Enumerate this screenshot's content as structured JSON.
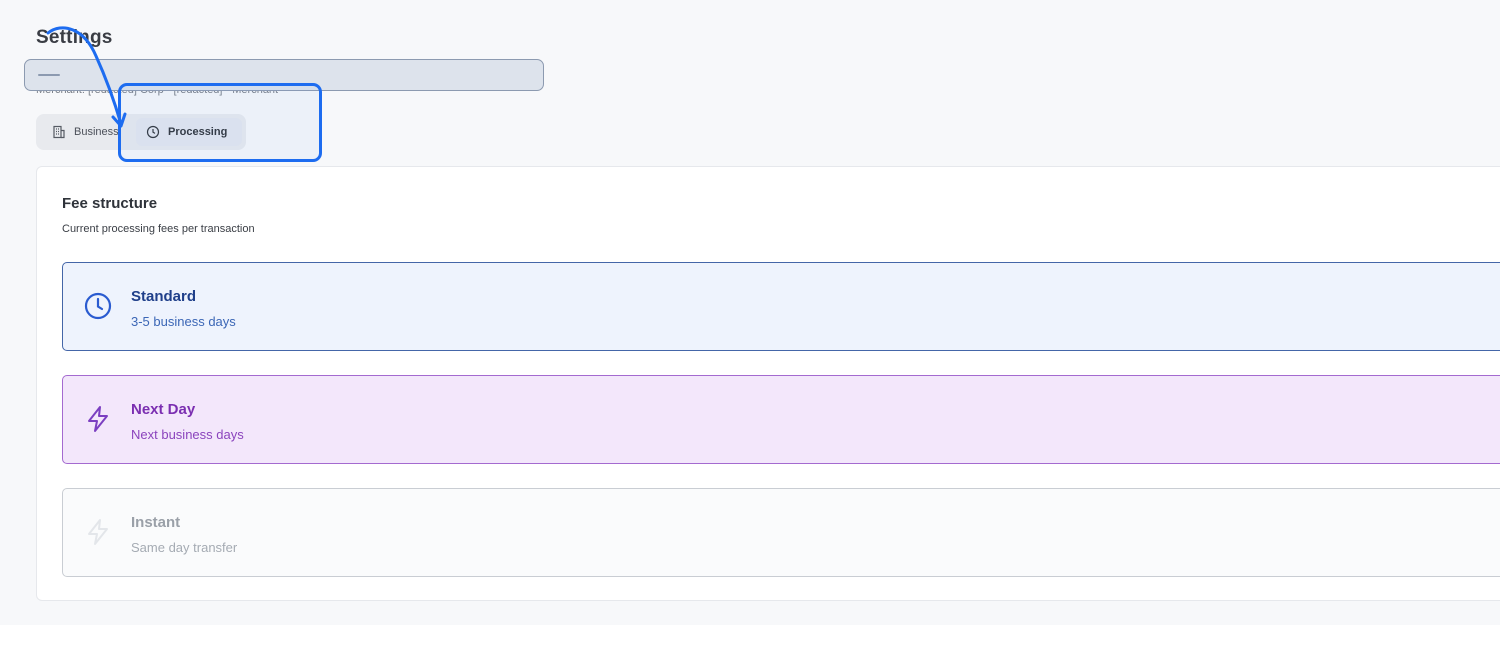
{
  "page": {
    "title": "Settings",
    "subtitle": "Merchant: [redacted] Corp · [redacted] · Merchant"
  },
  "tabs": [
    {
      "label": "Business",
      "icon": "building-icon",
      "selected": false
    },
    {
      "label": "Processing",
      "icon": "clock-icon",
      "selected": true
    }
  ],
  "fee_structure": {
    "title": "Fee structure",
    "subtitle": "Current processing fees per transaction",
    "options": [
      {
        "name": "Standard",
        "description": "3-5 business days",
        "icon": "clock-icon",
        "accent": "#1f3f8a"
      },
      {
        "name": "Next Day",
        "description": "Next business days",
        "icon": "lightning-icon",
        "accent": "#7b2fb1"
      },
      {
        "name": "Instant",
        "description": "Same day transfer",
        "icon": "lightning-icon",
        "accent": "#c9cdd3",
        "disabled": true
      }
    ]
  },
  "annotation": {
    "highlight_color": "#1d6cf0"
  }
}
